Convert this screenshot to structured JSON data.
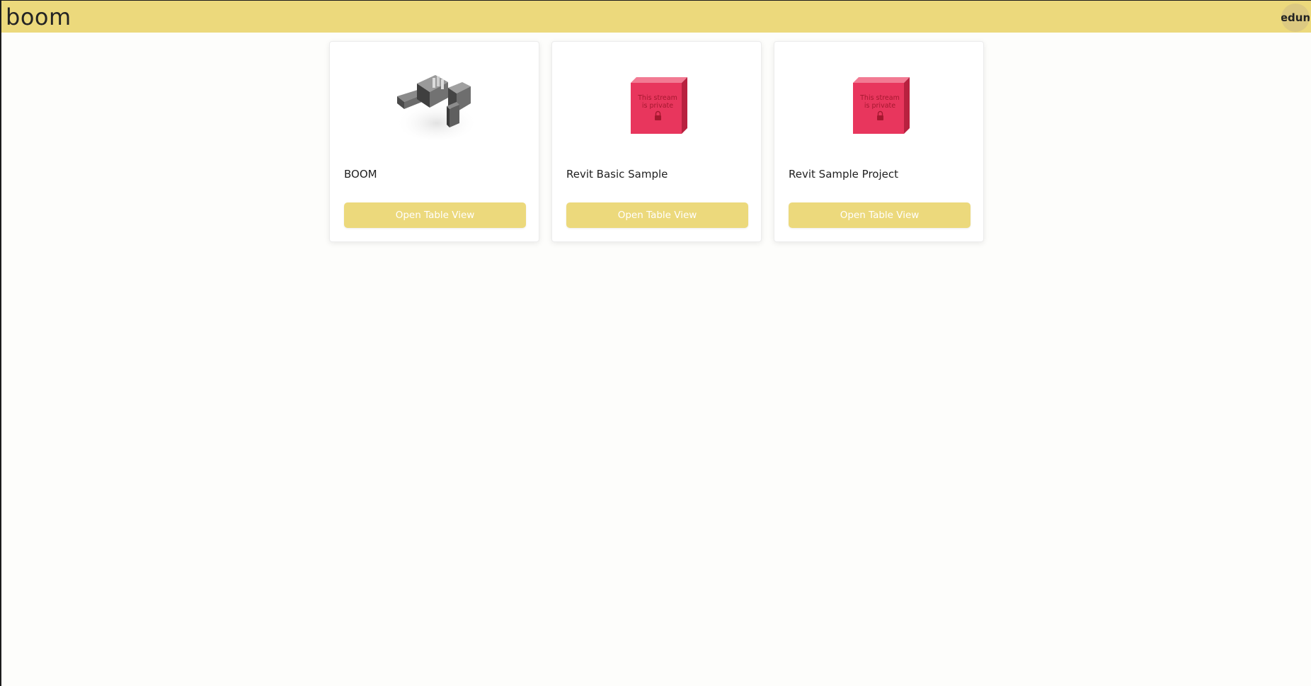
{
  "header": {
    "brand": "boom",
    "user_avatar_text": "edun"
  },
  "colors": {
    "accent": "#ecd97c",
    "private_box": "#e8365d"
  },
  "cards": [
    {
      "title": "BOOM",
      "thumbnail_icon": "building-model-thumbnail",
      "button_label": "Open Table View"
    },
    {
      "title": "Revit Basic Sample",
      "thumbnail_icon": "private-stream-box",
      "thumbnail_text_line1": "This stream",
      "thumbnail_text_line2": "is private",
      "button_label": "Open Table View"
    },
    {
      "title": "Revit Sample Project",
      "thumbnail_icon": "private-stream-box",
      "thumbnail_text_line1": "This stream",
      "thumbnail_text_line2": "is private",
      "button_label": "Open Table View"
    }
  ]
}
